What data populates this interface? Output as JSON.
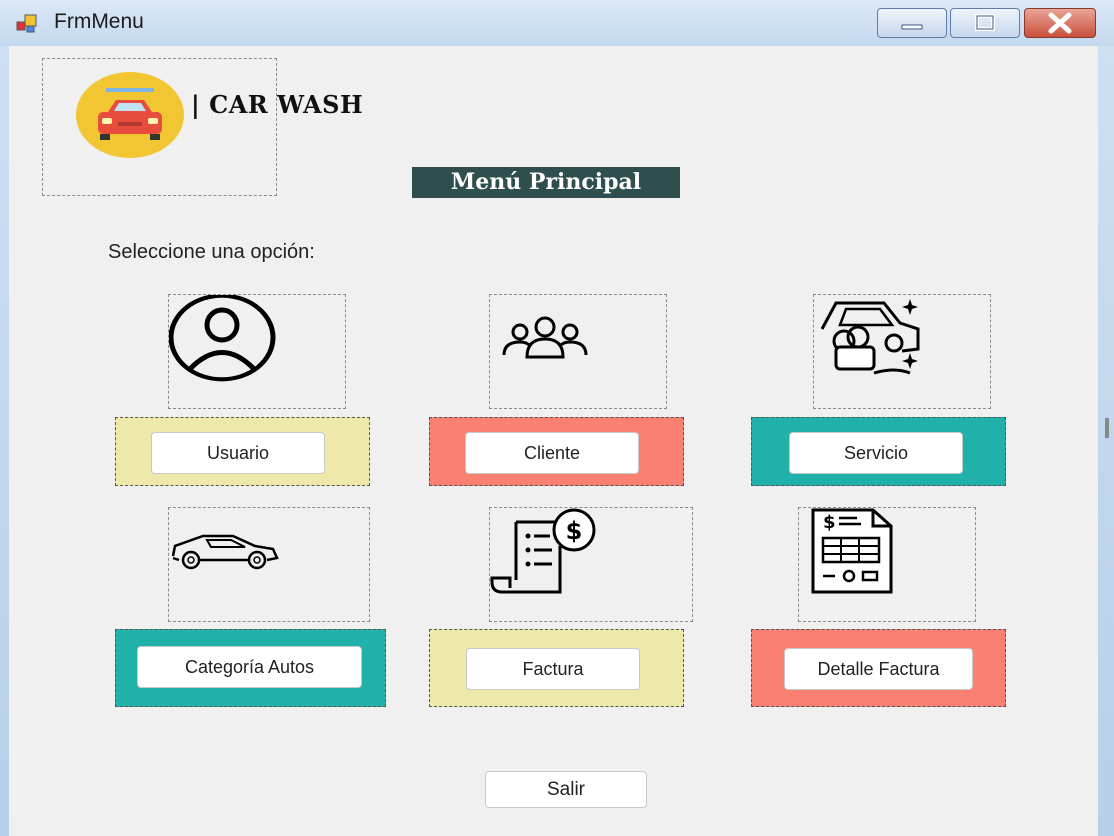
{
  "window": {
    "title": "FrmMenu"
  },
  "header": {
    "brand": "| CAR WASH",
    "menu_title": "Menú Principal",
    "prompt": "Seleccione una opción:"
  },
  "options": [
    {
      "label": "Usuario",
      "icon": "user-icon",
      "color": "#eee8aa"
    },
    {
      "label": "Cliente",
      "icon": "group-icon",
      "color": "#fa8072"
    },
    {
      "label": "Servicio",
      "icon": "car-wash-icon",
      "color": "#20b2aa"
    },
    {
      "label": "Categoría Autos",
      "icon": "car-icon",
      "color": "#20b2aa"
    },
    {
      "label": "Factura",
      "icon": "invoice-icon",
      "color": "#eee8aa"
    },
    {
      "label": "Detalle Factura",
      "icon": "invoice-detail-icon",
      "color": "#fa8072"
    }
  ],
  "footer": {
    "exit_label": "Salir"
  }
}
